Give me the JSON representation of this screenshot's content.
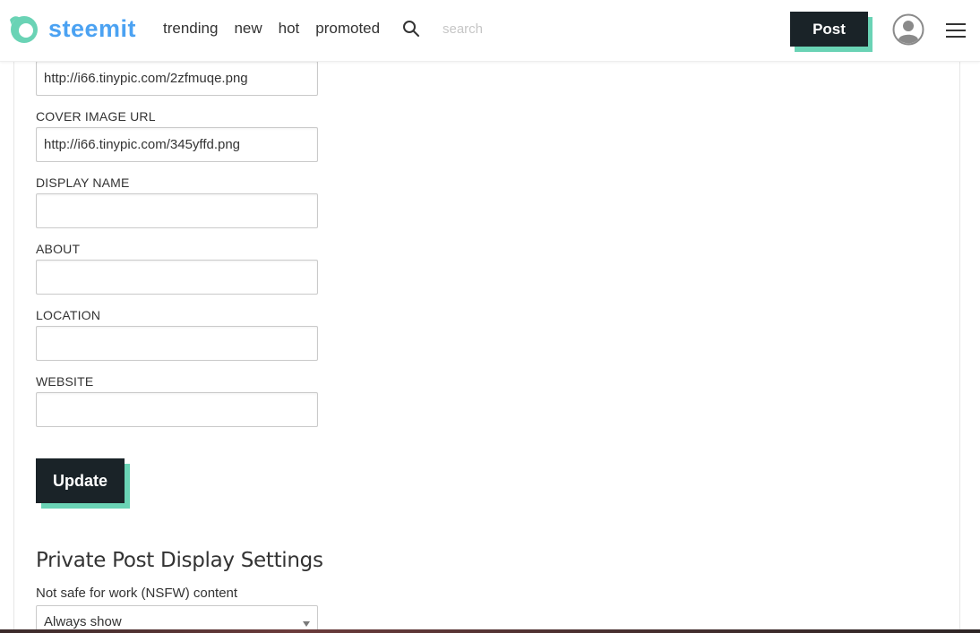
{
  "header": {
    "logo_text": "steemit",
    "nav": [
      "trending",
      "new",
      "hot",
      "promoted"
    ],
    "search_placeholder": "search",
    "post_label": "Post"
  },
  "form": {
    "profile_image_value": "http://i66.tinypic.com/2zfmuqe.png",
    "cover_label": "COVER IMAGE URL",
    "cover_value": "http://i66.tinypic.com/345yffd.png",
    "display_name_label": "DISPLAY NAME",
    "display_name_value": "",
    "about_label": "ABOUT",
    "about_value": "",
    "location_label": "LOCATION",
    "location_value": "",
    "website_label": "WEBSITE",
    "website_value": "",
    "update_label": "Update"
  },
  "private_settings": {
    "title": "Private Post Display Settings",
    "nsfw_label": "Not safe for work (NSFW) content",
    "nsfw_selected": "Always show"
  },
  "colors": {
    "brand_blue": "#4ba2f2",
    "brand_green": "#6ad3b5",
    "button_dark": "#1a2328"
  },
  "icons": {
    "search": "search-icon",
    "avatar": "user-avatar-icon",
    "menu": "hamburger-menu-icon",
    "logo": "steemit-logo-icon"
  }
}
